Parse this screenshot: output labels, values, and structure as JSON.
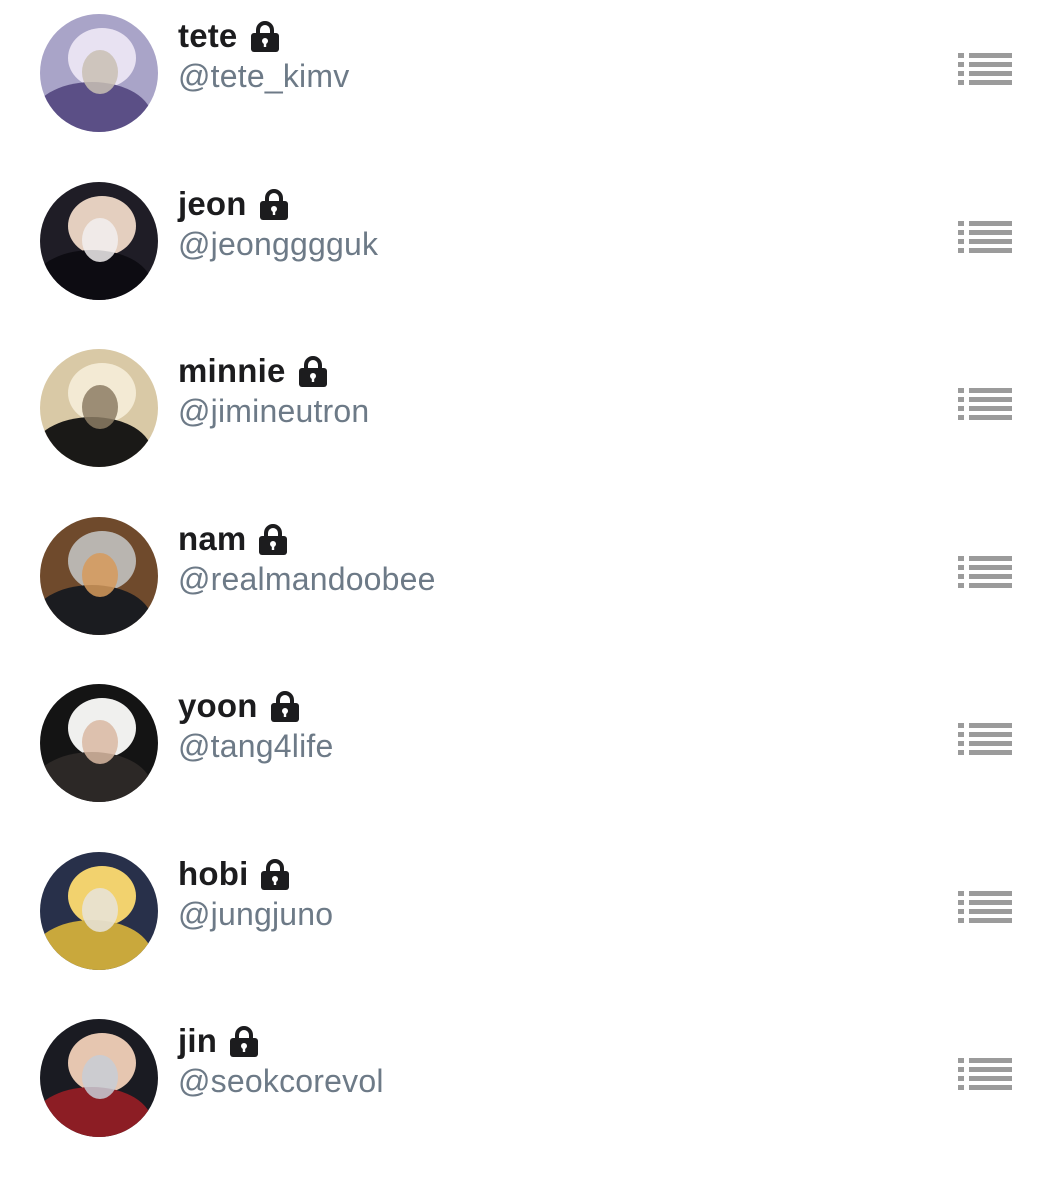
{
  "members": [
    {
      "display_name": "tete",
      "handle": "@tete_kimv",
      "locked": true,
      "avatar_icon": "profile-photo",
      "avatar_colors": [
        "#a9a4c8",
        "#e8e2f2",
        "#5b4f86",
        "#c9c0b4"
      ]
    },
    {
      "display_name": "jeon",
      "handle": "@jeongggguk",
      "locked": true,
      "avatar_icon": "profile-photo",
      "avatar_colors": [
        "#1f1d26",
        "#e4cfbf",
        "#0d0c12",
        "#f2efee"
      ]
    },
    {
      "display_name": "minnie",
      "handle": "@jimineutron",
      "locked": true,
      "avatar_icon": "profile-photo",
      "avatar_colors": [
        "#d9c9a6",
        "#f3ead4",
        "#1a1917",
        "#8c7d64"
      ]
    },
    {
      "display_name": "nam",
      "handle": "@realmandoobee",
      "locked": true,
      "avatar_icon": "profile-photo",
      "avatar_colors": [
        "#6f4a2c",
        "#b9b5b0",
        "#1b1c20",
        "#d69a5c"
      ]
    },
    {
      "display_name": "yoon",
      "handle": "@tang4life",
      "locked": true,
      "avatar_icon": "profile-photo",
      "avatar_colors": [
        "#141414",
        "#f0f0ee",
        "#2c2826",
        "#d9b8a2"
      ]
    },
    {
      "display_name": "hobi",
      "handle": "@jungjuno",
      "locked": true,
      "avatar_icon": "profile-photo",
      "avatar_colors": [
        "#28304a",
        "#f2d26e",
        "#c9a83c",
        "#e8e4dc"
      ]
    },
    {
      "display_name": "jin",
      "handle": "@seokcorevol",
      "locked": true,
      "avatar_icon": "profile-photo",
      "avatar_colors": [
        "#1a1b22",
        "#e6c6b0",
        "#8c1d24",
        "#c7ccd6"
      ]
    }
  ],
  "icons": {
    "lock": "lock-icon",
    "menu": "list-menu-icon"
  },
  "colors": {
    "name_text": "#1c1c1e",
    "handle_text": "#6d7a87",
    "menu_icon": "#9b9b9b",
    "lock_icon": "#1c1c1e",
    "background": "#ffffff"
  }
}
